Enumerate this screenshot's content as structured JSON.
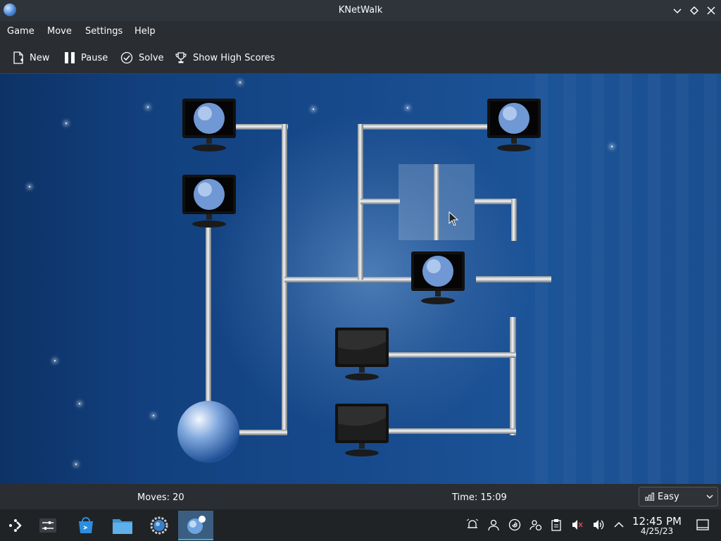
{
  "window": {
    "title": "KNetWalk"
  },
  "menu": {
    "items": [
      "Game",
      "Move",
      "Settings",
      "Help"
    ]
  },
  "toolbar": {
    "new_label": "New",
    "pause_label": "Pause",
    "solve_label": "Solve",
    "highscores_label": "Show High Scores"
  },
  "status": {
    "moves": "Moves: 20",
    "time": "Time: 15:09"
  },
  "difficulty": {
    "selected": "Easy"
  },
  "clock": {
    "time": "12:45 PM",
    "date": "4/25/23"
  },
  "colors": {
    "board": "#174a8c",
    "accent": "#3daee9",
    "chrome": "#2a2e32"
  },
  "taskbar": {
    "icons": [
      "application-launcher-icon",
      "system-settings-mixer-icon",
      "discover-store-icon",
      "file-manager-icon",
      "settings-gear-icon",
      "knetwalk-icon"
    ]
  },
  "tray": {
    "icons": [
      "alarm-icon",
      "user-icon",
      "update-icon",
      "accounts-icon",
      "clipboard-icon",
      "mute-icon",
      "volume-icon",
      "tray-expand-icon",
      "show-desktop-icon"
    ]
  }
}
